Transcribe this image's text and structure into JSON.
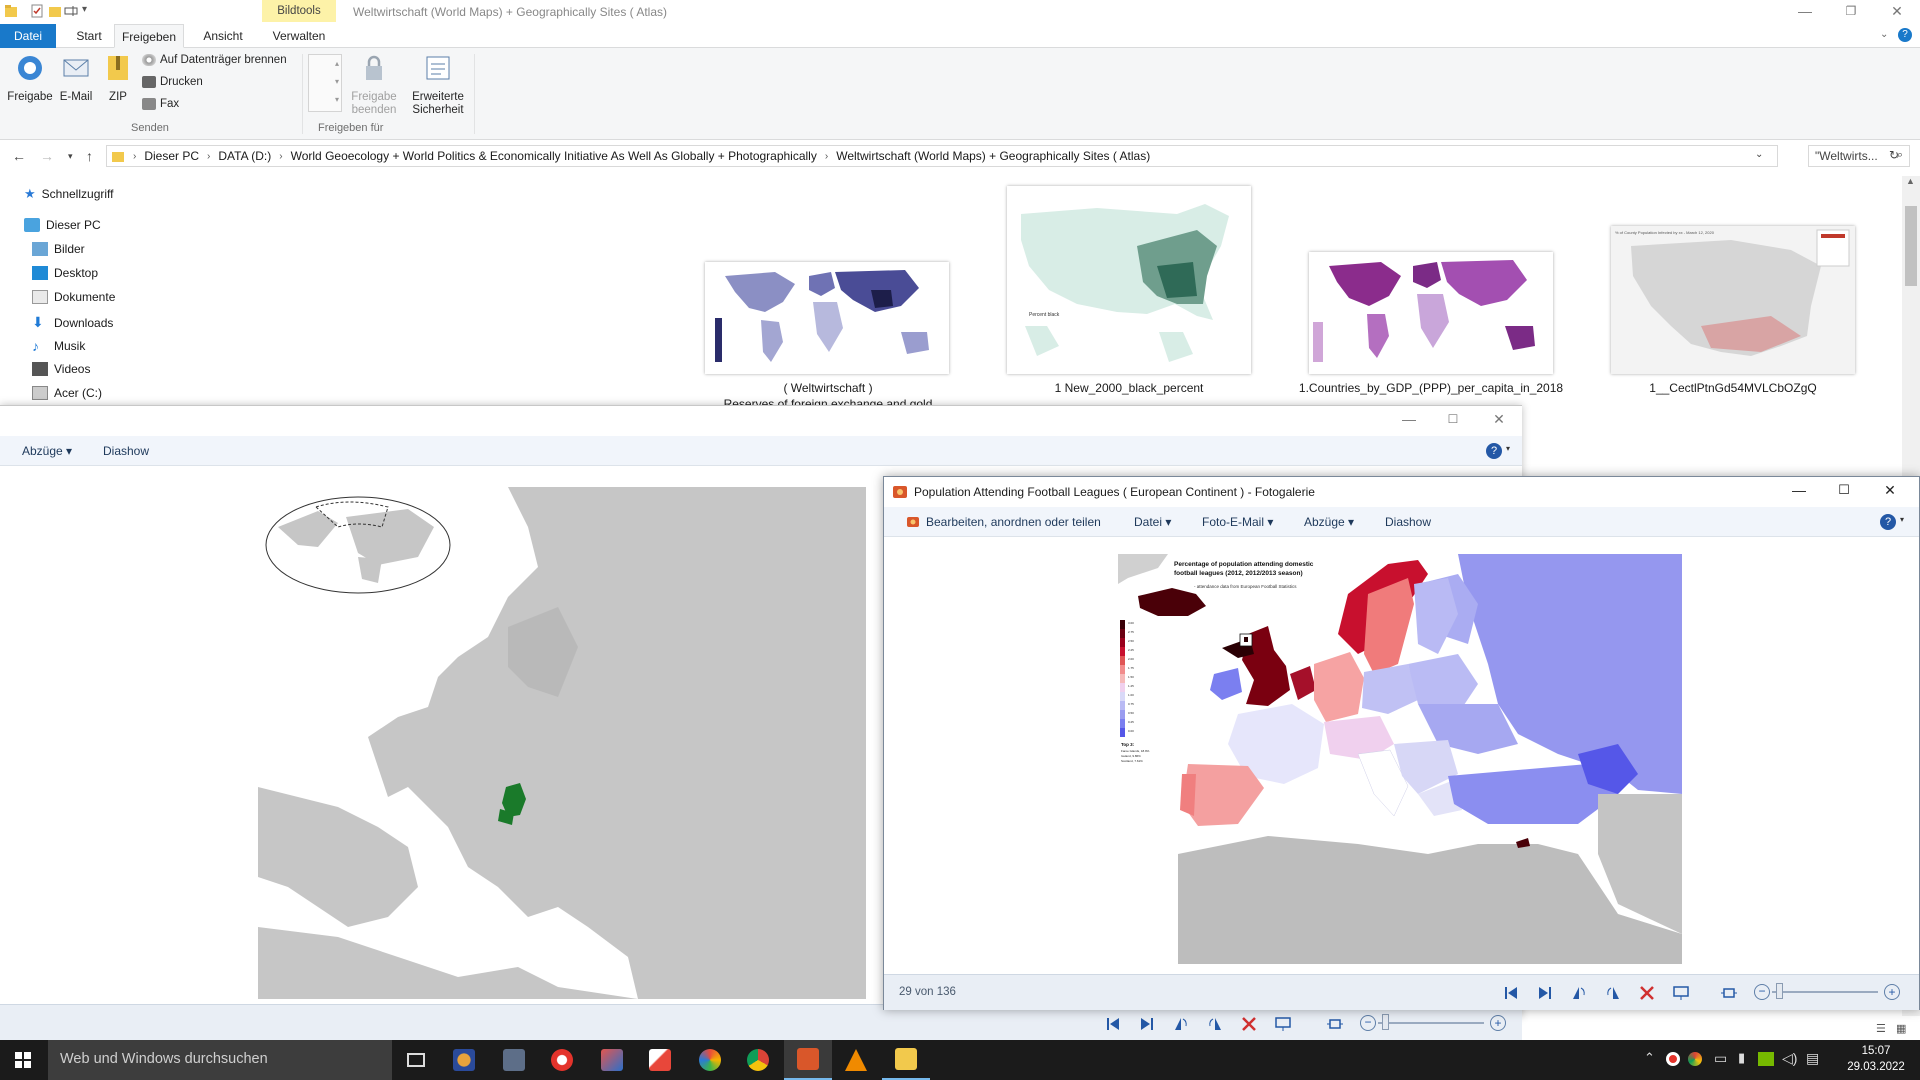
{
  "explorer": {
    "window_title": "Weltwirtschaft (World Maps) + Geographically Sites ( Atlas)",
    "context_tab": "Bildtools",
    "tabs": [
      "Datei",
      "Start",
      "Freigeben",
      "Ansicht",
      "Verwalten"
    ],
    "ribbon": {
      "share_label": "Freigabe",
      "email_label": "E-Mail",
      "zip_label": "ZIP",
      "burn_label": "Auf Datenträger brennen",
      "print_label": "Drucken",
      "fax_label": "Fax",
      "group_send": "Senden",
      "stop_share_label": "Freigabe beenden",
      "advanced_security_label": "Erweiterte Sicherheit",
      "group_share_with": "Freigeben für"
    },
    "breadcrumbs": [
      "Dieser PC",
      "DATA (D:)",
      "World Geoecology + World Politics & Economically Initiative As Well As Globally + Photographically",
      "Weltwirtschaft (World Maps) + Geographically Sites ( Atlas)"
    ],
    "search_placeholder": "\"Weltwirts...",
    "nav": {
      "quick_access": "Schnellzugriff",
      "this_pc": "Dieser PC",
      "items": [
        "Bilder",
        "Desktop",
        "Dokumente",
        "Downloads",
        "Musik",
        "Videos",
        "Acer (C:)"
      ]
    },
    "files": [
      {
        "name": "( Weltwirtschaft )",
        "name2": "Reserves of foreign exchange and gold"
      },
      {
        "name": "1 New_2000_black_percent"
      },
      {
        "name": "1.Countries_by_GDP_(PPP)_per_capita_in_2018"
      },
      {
        "name": "1__CectlPtnGd54MVLCbOZgQ"
      }
    ],
    "thumb_captions": {
      "us_legend": "Percent black",
      "covid_title": "% of County Population Infected by xx - March 12, 2020"
    }
  },
  "gallery_back": {
    "menu": [
      "Abzüge",
      "Diashow"
    ]
  },
  "gallery_front": {
    "title": "Population Attending Football Leagues ( European Continent ) - Fotogalerie",
    "menu": [
      "Bearbeiten, anordnen oder teilen",
      "Datei",
      "Foto-E-Mail",
      "Abzüge",
      "Diashow"
    ],
    "counter": "29 von 136",
    "map": {
      "title_line1": "Percentage of population attending domestic",
      "title_line2": "football leagues (2012, 2012/2013 season)",
      "source": "- attendance data from European Football Statistics",
      "legend_title": "Top 3:",
      "legend_top3": [
        "Faroe Islands, 18.9%",
        "Iceland, 9.86%",
        "Scotland, 7.61%"
      ],
      "legend_steps": [
        "3.00",
        "2.75",
        "2.50",
        "2.25",
        "2.00",
        "1.75",
        "1.50",
        "1.25",
        "1.00",
        "0.75",
        "0.50",
        "0.25",
        "0.00"
      ]
    }
  },
  "taskbar": {
    "search_placeholder": "Web und Windows durchsuchen",
    "time": "15:07",
    "date": "29.03.2022"
  },
  "colors": {
    "accent": "#1979ca",
    "context_tab": "#fdf2a8",
    "taskbar": "#1b1b1b",
    "highlight_country": "#1a7a2a",
    "map_gray": "#c4c4c4",
    "map_red_dark": "#5a0010",
    "map_blue": "#9a9cf0"
  }
}
